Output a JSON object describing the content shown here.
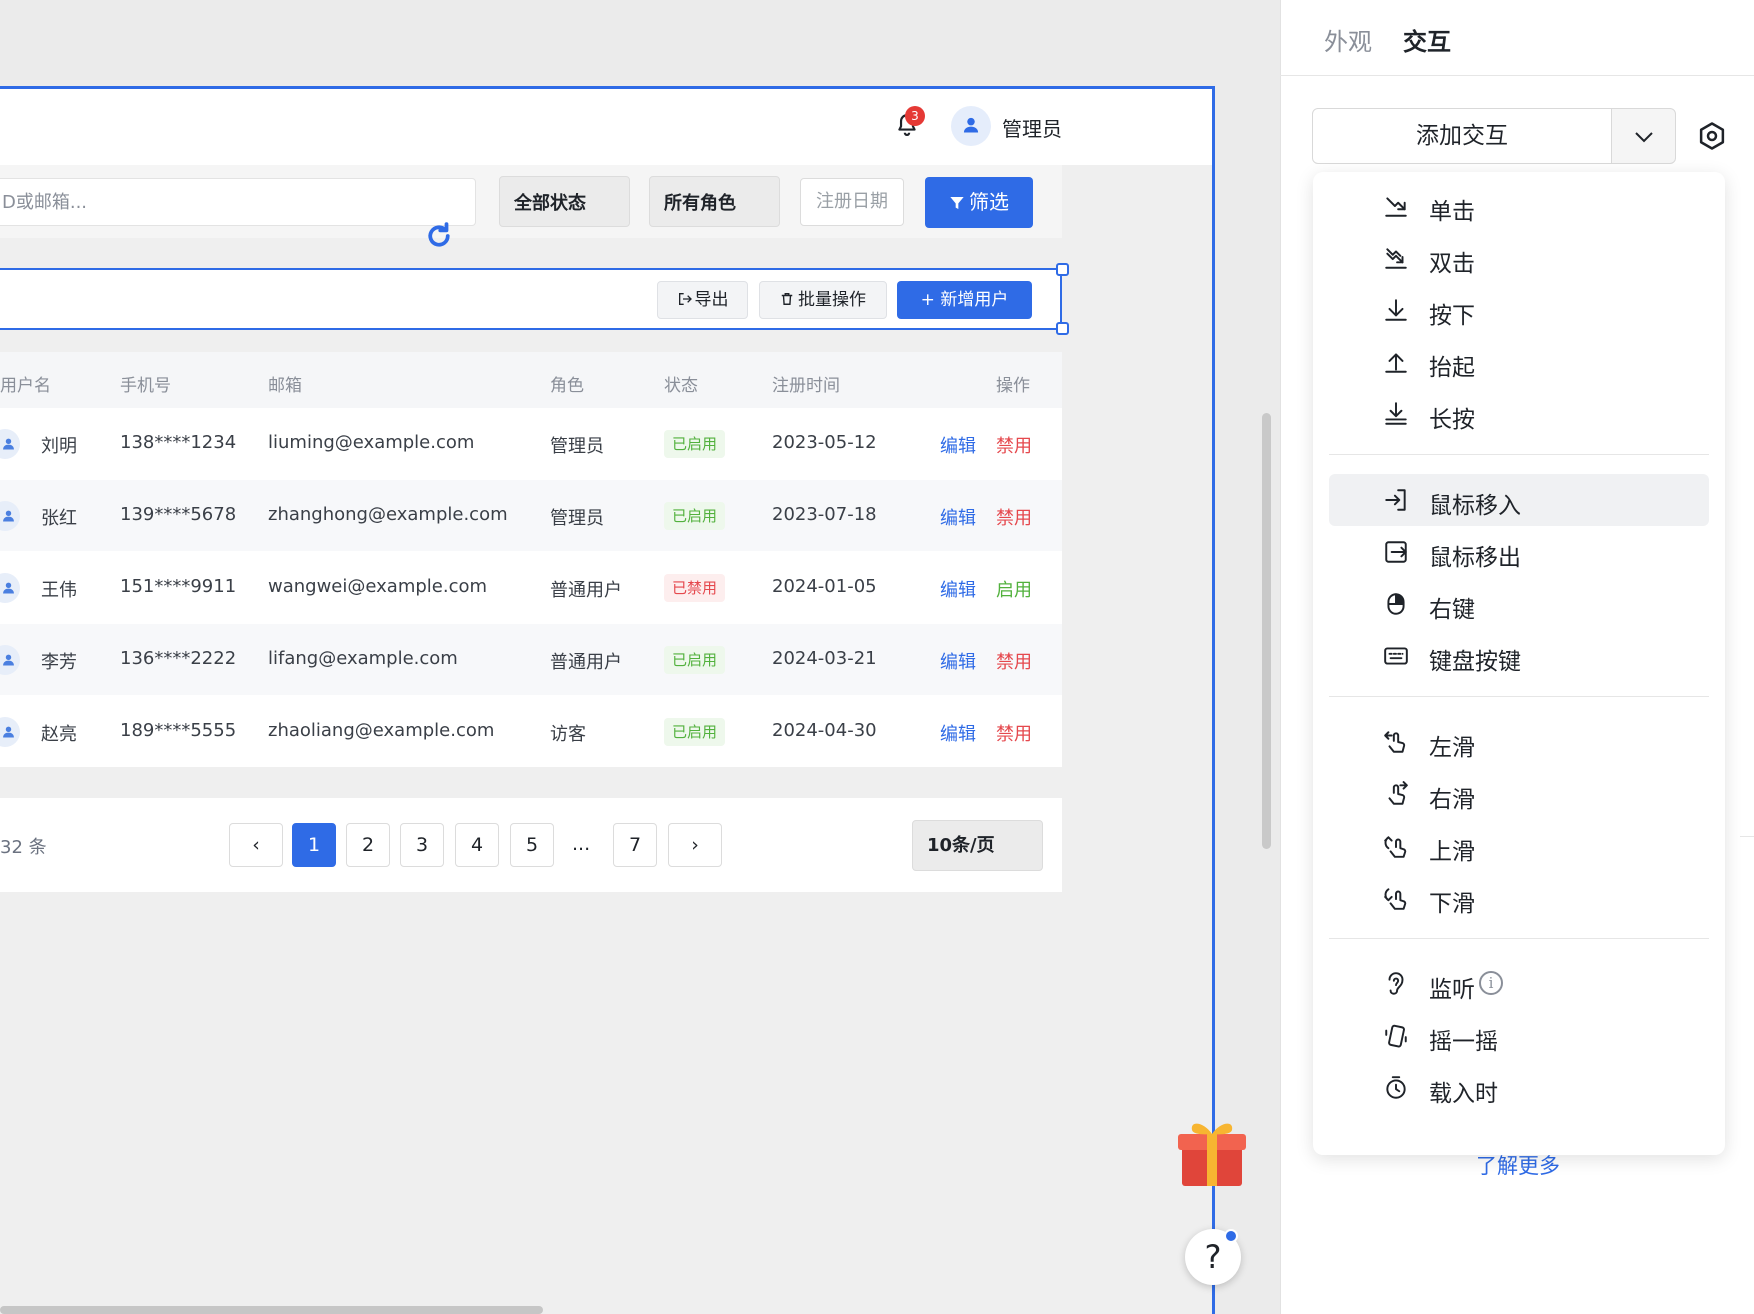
{
  "header": {
    "notification_count": "3",
    "admin_name": "管理员"
  },
  "filters": {
    "search_placeholder": "D或邮箱...",
    "status": "全部状态",
    "role": "所有角色",
    "date_placeholder": "注册日期",
    "filter_button": "筛选"
  },
  "toolbar": {
    "export": "导出",
    "bulk": "批量操作",
    "add_user": "+ 新增用户"
  },
  "table": {
    "columns": [
      "用户名",
      "手机号",
      "邮箱",
      "角色",
      "状态",
      "注册时间",
      "操作"
    ],
    "rows": [
      {
        "name": "刘明",
        "phone": "138****1234",
        "email": "liuming@example.com",
        "role": "管理员",
        "status": "已启用",
        "status_type": "on",
        "date": "2023-05-12",
        "edit": "编辑",
        "toggle": "禁用"
      },
      {
        "name": "张红",
        "phone": "139****5678",
        "email": "zhanghong@example.com",
        "role": "管理员",
        "status": "已启用",
        "status_type": "on",
        "date": "2023-07-18",
        "edit": "编辑",
        "toggle": "禁用"
      },
      {
        "name": "王伟",
        "phone": "151****9911",
        "email": "wangwei@example.com",
        "role": "普通用户",
        "status": "已禁用",
        "status_type": "off",
        "date": "2024-01-05",
        "edit": "编辑",
        "toggle": "启用"
      },
      {
        "name": "李芳",
        "phone": "136****2222",
        "email": "lifang@example.com",
        "role": "普通用户",
        "status": "已启用",
        "status_type": "on",
        "date": "2024-03-21",
        "edit": "编辑",
        "toggle": "禁用"
      },
      {
        "name": "赵亮",
        "phone": "189****5555",
        "email": "zhaoliang@example.com",
        "role": "访客",
        "status": "已启用",
        "status_type": "on",
        "date": "2024-04-30",
        "edit": "编辑",
        "toggle": "禁用"
      }
    ]
  },
  "pagination": {
    "total": "32 条",
    "prev": "‹",
    "next": "›",
    "pages": [
      "1",
      "2",
      "3",
      "4",
      "5",
      "7"
    ],
    "ellipsis": "...",
    "current": "1",
    "page_size": "10条/页"
  },
  "help": "?",
  "panel": {
    "tabs": [
      "外观",
      "交互"
    ],
    "active_tab": "交互",
    "add_interaction": "添加交互",
    "learn_more": "了解更多"
  },
  "menu": {
    "groups": [
      [
        {
          "label": "单击",
          "icon": "click-icon"
        },
        {
          "label": "双击",
          "icon": "double-click-icon"
        },
        {
          "label": "按下",
          "icon": "press-down-icon"
        },
        {
          "label": "抬起",
          "icon": "lift-up-icon"
        },
        {
          "label": "长按",
          "icon": "long-press-icon"
        }
      ],
      [
        {
          "label": "鼠标移入",
          "icon": "mouse-enter-icon",
          "highlighted": true
        },
        {
          "label": "鼠标移出",
          "icon": "mouse-leave-icon"
        },
        {
          "label": "右键",
          "icon": "right-click-icon"
        },
        {
          "label": "键盘按键",
          "icon": "keyboard-icon"
        }
      ],
      [
        {
          "label": "左滑",
          "icon": "swipe-left-icon"
        },
        {
          "label": "右滑",
          "icon": "swipe-right-icon"
        },
        {
          "label": "上滑",
          "icon": "swipe-up-icon"
        },
        {
          "label": "下滑",
          "icon": "swipe-down-icon"
        }
      ],
      [
        {
          "label": "监听",
          "icon": "listen-icon",
          "info": true
        },
        {
          "label": "摇一摇",
          "icon": "shake-icon"
        },
        {
          "label": "载入时",
          "icon": "on-load-icon"
        }
      ]
    ]
  },
  "colors": {
    "primary": "#2f6be6",
    "success": "#52b13d",
    "danger": "#e5484d"
  }
}
